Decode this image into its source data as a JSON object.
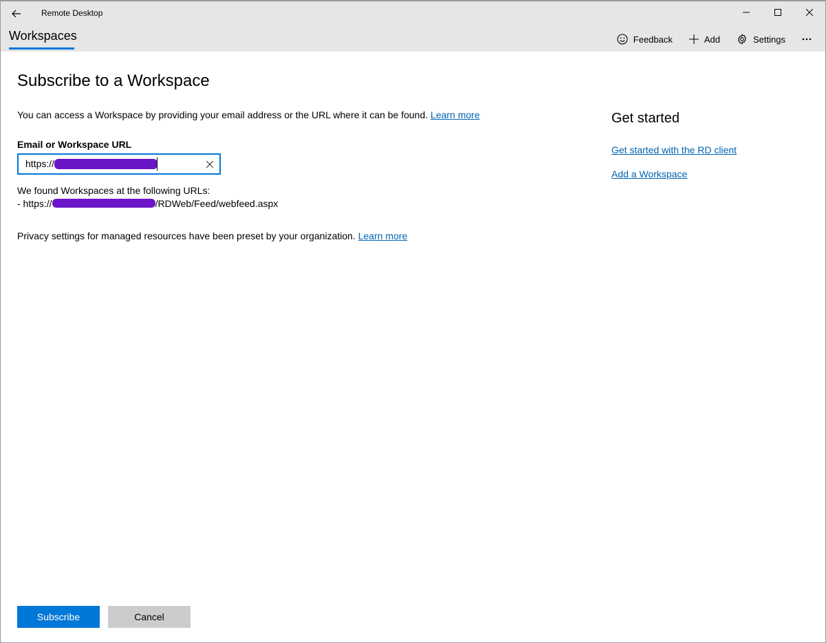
{
  "window": {
    "title": "Remote Desktop",
    "accent": "#0078d7"
  },
  "header": {
    "tab_label": "Workspaces",
    "toolbar": {
      "feedback_label": "Feedback",
      "add_label": "Add",
      "settings_label": "Settings"
    }
  },
  "main": {
    "title": "Subscribe to a Workspace",
    "intro_text": "You can access a Workspace by providing your email address or the URL where it can be found.",
    "intro_link": "Learn more",
    "field_label": "Email or Workspace URL",
    "field_value_prefix": "https://",
    "found_title": "We found Workspaces at the following URLs:",
    "found_prefix": "- https://",
    "found_suffix": "/RDWeb/Feed/webfeed.aspx",
    "privacy_text": "Privacy settings for managed resources have been preset by your organization.",
    "privacy_link": "Learn more"
  },
  "sidebar": {
    "title": "Get started",
    "links": [
      "Get started with the RD client",
      "Add a Workspace"
    ]
  },
  "footer": {
    "subscribe_label": "Subscribe",
    "cancel_label": "Cancel"
  },
  "colors": {
    "redaction": "#6a16c8",
    "link": "#0063b1",
    "header_bg": "#e6e6e6"
  }
}
